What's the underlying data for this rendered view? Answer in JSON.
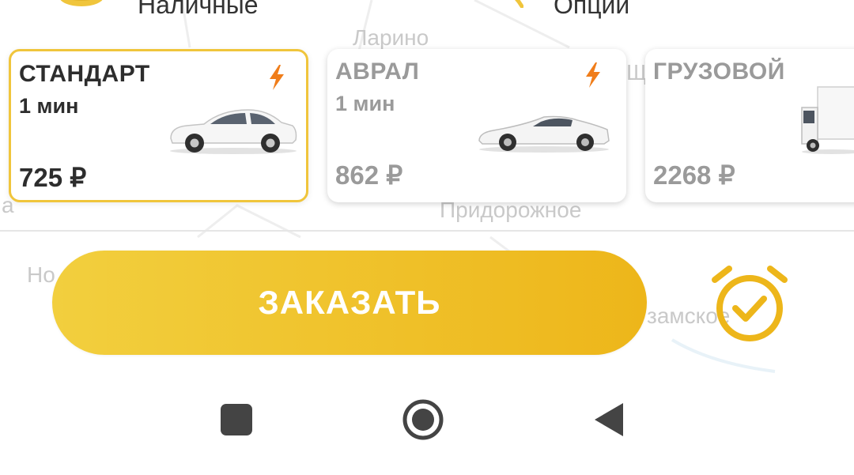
{
  "top_bar": {
    "payment_label": "Наличные",
    "options_label": "Опции"
  },
  "map": {
    "labels": [
      "Ларино",
      "Придорожное",
      "Но",
      "замское",
      "а",
      "Щ"
    ]
  },
  "tariffs": [
    {
      "name": "СТАНДАРТ",
      "eta": "1 мин",
      "price": "725 ₽",
      "selected": true,
      "surge": true,
      "vehicle": "sedan"
    },
    {
      "name": "АВРАЛ",
      "eta": "1 мин",
      "price": "862 ₽",
      "selected": false,
      "surge": true,
      "vehicle": "sports-car"
    },
    {
      "name": "ГРУЗОВОЙ",
      "eta": "",
      "price": "2268 ₽",
      "selected": false,
      "surge": false,
      "vehicle": "truck"
    }
  ],
  "order_button": {
    "label": "ЗАКАЗАТЬ"
  },
  "schedule_icon": "alarm-clock-check-icon",
  "navigation_bar": [
    "recent-apps-icon",
    "home-icon",
    "back-icon"
  ],
  "colors": {
    "accent": "#f0c53c",
    "button_start": "#f2cf3e",
    "button_end": "#edb61a",
    "surge_bolt": "#f07d1a",
    "text_dark": "#2d2d2d",
    "text_dim": "#9a9a9a"
  }
}
